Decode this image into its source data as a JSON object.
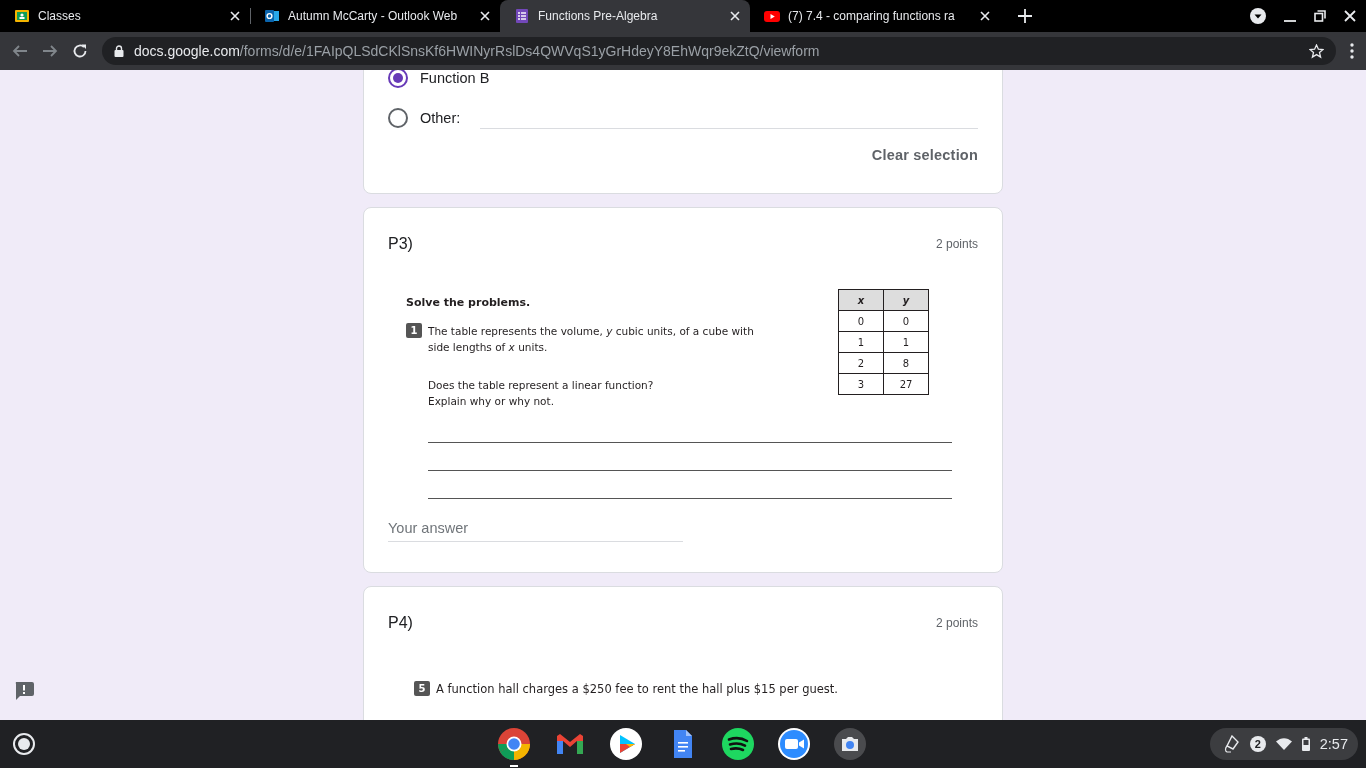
{
  "browser": {
    "tabs": [
      {
        "title": "Classes",
        "selected": false
      },
      {
        "title": "Autumn McCarty - Outlook Web",
        "selected": false
      },
      {
        "title": "Functions Pre-Algebra",
        "selected": true
      },
      {
        "title": "(7) 7.4 - comparing functions ra",
        "selected": false
      }
    ],
    "url_host": "docs.google.com",
    "url_path": "/forms/d/e/1FAIpQLSdCKlSnsKf6HWINyrRslDs4QWVqS1yGrHdeyY8EhWqr9ekZtQ/viewform"
  },
  "previous_question": {
    "options": [
      {
        "kind": "choice",
        "label": "Function B",
        "selected": true
      },
      {
        "kind": "other",
        "label": "Other:",
        "selected": false
      }
    ],
    "clear_selection": "Clear selection"
  },
  "questions": [
    {
      "title": "P3)",
      "points": "2 points",
      "worksheet": {
        "heading": "Solve the problems.",
        "problem_number": "1",
        "problem_text": "The table represents the volume, *y* cubic units, of a cube with side lengths of *x* units.",
        "question": [
          "Does the table represent a linear function?",
          "Explain why or why not."
        ],
        "table": {
          "columns": [
            "x",
            "y"
          ],
          "rows": [
            [
              "0",
              "0"
            ],
            [
              "1",
              "1"
            ],
            [
              "2",
              "8"
            ],
            [
              "3",
              "27"
            ]
          ]
        }
      },
      "answer_placeholder": "Your answer"
    },
    {
      "title": "P4)",
      "points": "2 points",
      "worksheet": {
        "problem_number": "5",
        "problem_text": "A function hall charges a $250 fee to rent the hall plus $15 per guest."
      }
    }
  ],
  "shelf": {
    "notification_count": "2",
    "time": "2:57"
  }
}
